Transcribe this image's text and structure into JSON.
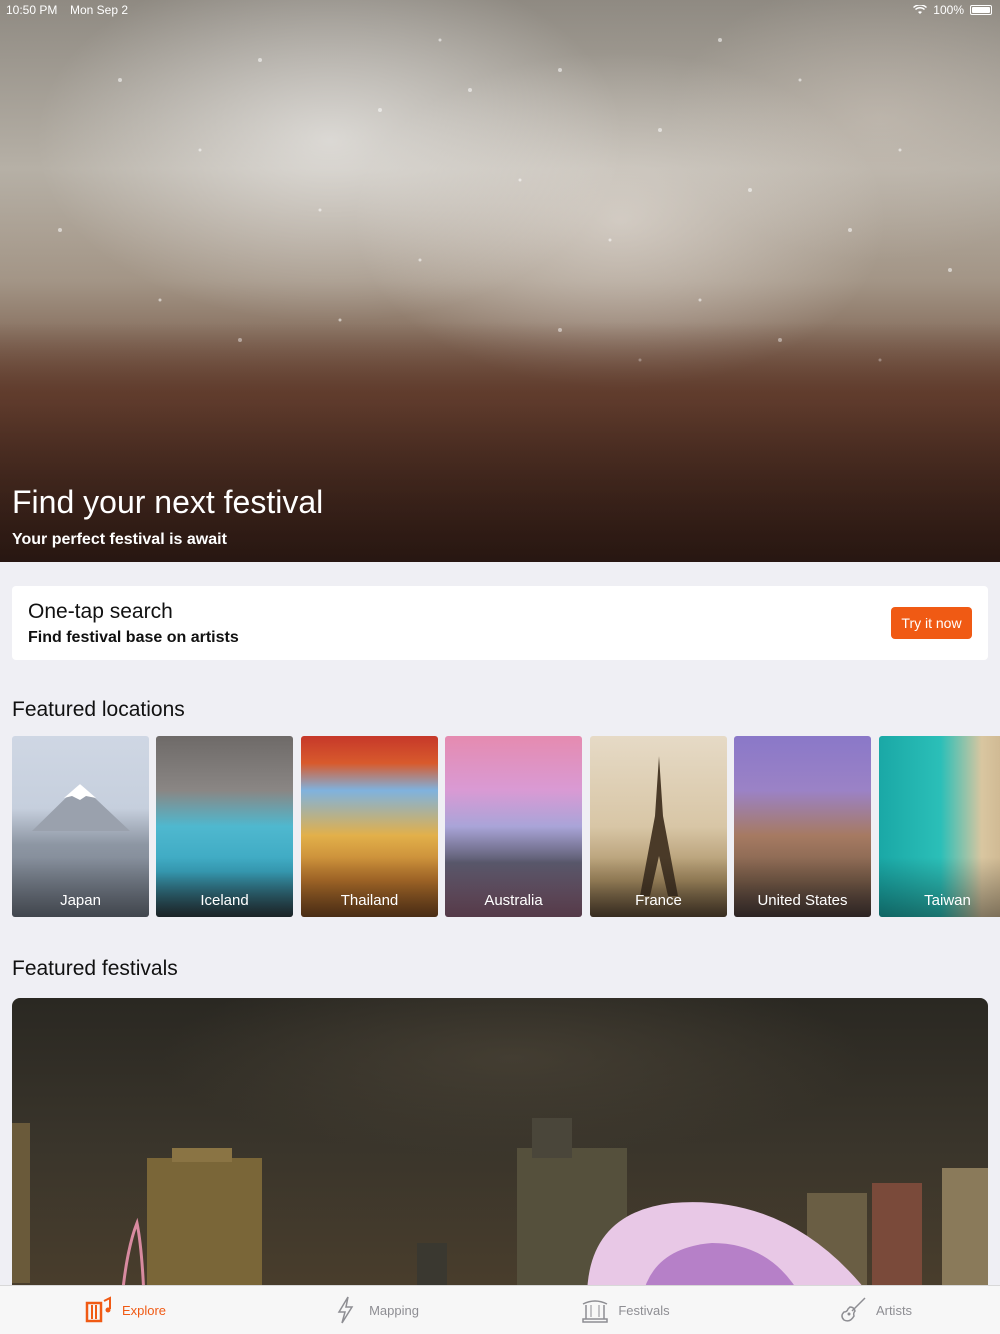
{
  "status": {
    "time": "10:50 PM",
    "date": "Mon Sep 2",
    "battery": "100%"
  },
  "hero": {
    "title": "Find your next festival",
    "subtitle": "Your perfect festival is await"
  },
  "one_tap": {
    "title": "One-tap search",
    "subtitle": "Find festival base on artists",
    "button": "Try it now"
  },
  "locations": {
    "title": "Featured locations",
    "items": [
      {
        "label": "Japan"
      },
      {
        "label": "Iceland"
      },
      {
        "label": "Thailand"
      },
      {
        "label": "Australia"
      },
      {
        "label": "France"
      },
      {
        "label": "United States"
      },
      {
        "label": "Taiwan"
      }
    ]
  },
  "festivals": {
    "title": "Featured festivals"
  },
  "tabs": [
    {
      "label": "Explore",
      "icon": "explore-icon",
      "active": true
    },
    {
      "label": "Mapping",
      "icon": "lightning-icon",
      "active": false
    },
    {
      "label": "Festivals",
      "icon": "stage-icon",
      "active": false
    },
    {
      "label": "Artists",
      "icon": "guitar-icon",
      "active": false
    }
  ],
  "colors": {
    "accent": "#f05a14",
    "background": "#efeff4"
  }
}
